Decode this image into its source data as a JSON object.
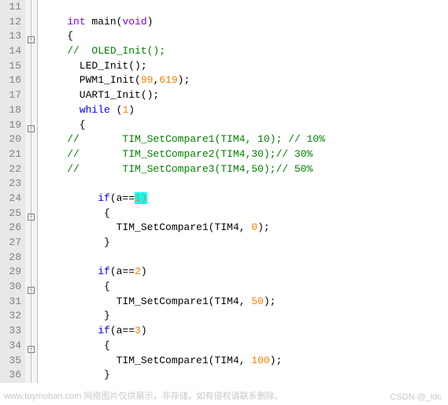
{
  "lines": [
    {
      "num": "11",
      "fold": "line",
      "code": ""
    },
    {
      "num": "12",
      "fold": "line",
      "segs": [
        {
          "t": "    "
        },
        {
          "t": "int",
          "c": "type"
        },
        {
          "t": " main("
        },
        {
          "t": "void",
          "c": "type"
        },
        {
          "t": ")"
        }
      ]
    },
    {
      "num": "13",
      "fold": "box",
      "segs": [
        {
          "t": "    {"
        }
      ]
    },
    {
      "num": "14",
      "fold": "line",
      "segs": [
        {
          "t": "    "
        },
        {
          "t": "//  OLED_Init();",
          "c": "comment"
        }
      ]
    },
    {
      "num": "15",
      "fold": "line",
      "segs": [
        {
          "t": "      LED_Init();"
        }
      ]
    },
    {
      "num": "16",
      "fold": "line",
      "segs": [
        {
          "t": "      PWM1_Init("
        },
        {
          "t": "99",
          "c": "num"
        },
        {
          "t": ","
        },
        {
          "t": "619",
          "c": "num"
        },
        {
          "t": ");"
        }
      ]
    },
    {
      "num": "17",
      "fold": "line",
      "segs": [
        {
          "t": "      UART1_Init();"
        }
      ]
    },
    {
      "num": "18",
      "fold": "line",
      "segs": [
        {
          "t": "      "
        },
        {
          "t": "while",
          "c": "kw"
        },
        {
          "t": " ("
        },
        {
          "t": "1",
          "c": "num"
        },
        {
          "t": ")"
        }
      ]
    },
    {
      "num": "19",
      "fold": "box",
      "segs": [
        {
          "t": "      {"
        }
      ]
    },
    {
      "num": "20",
      "fold": "line",
      "segs": [
        {
          "t": "    "
        },
        {
          "t": "//       TIM_SetCompare1(TIM4, 10); // 10%",
          "c": "comment"
        }
      ]
    },
    {
      "num": "21",
      "fold": "line",
      "segs": [
        {
          "t": "    "
        },
        {
          "t": "//       TIM_SetCompare2(TIM4,30);// 30%",
          "c": "comment"
        }
      ]
    },
    {
      "num": "22",
      "fold": "line",
      "segs": [
        {
          "t": "    "
        },
        {
          "t": "//       TIM_SetCompare3(TIM4,50);// 50%",
          "c": "comment"
        }
      ]
    },
    {
      "num": "23",
      "fold": "line",
      "code": ""
    },
    {
      "num": "24",
      "fold": "line",
      "segs": [
        {
          "t": "         "
        },
        {
          "t": "if",
          "c": "kw"
        },
        {
          "t": "(a=="
        },
        {
          "t": "1)",
          "c": "num highlight"
        }
      ]
    },
    {
      "num": "25",
      "fold": "box",
      "segs": [
        {
          "t": "          {"
        }
      ]
    },
    {
      "num": "26",
      "fold": "line",
      "segs": [
        {
          "t": "            TIM_SetCompare1(TIM4, "
        },
        {
          "t": "0",
          "c": "num"
        },
        {
          "t": ");"
        }
      ]
    },
    {
      "num": "27",
      "fold": "line",
      "segs": [
        {
          "t": "          }"
        }
      ]
    },
    {
      "num": "28",
      "fold": "line",
      "code": ""
    },
    {
      "num": "29",
      "fold": "line",
      "segs": [
        {
          "t": "         "
        },
        {
          "t": "if",
          "c": "kw"
        },
        {
          "t": "(a=="
        },
        {
          "t": "2",
          "c": "num"
        },
        {
          "t": ")"
        }
      ]
    },
    {
      "num": "30",
      "fold": "box",
      "segs": [
        {
          "t": "          {"
        }
      ]
    },
    {
      "num": "31",
      "fold": "line",
      "segs": [
        {
          "t": "            TIM_SetCompare1(TIM4, "
        },
        {
          "t": "50",
          "c": "num"
        },
        {
          "t": ");"
        }
      ]
    },
    {
      "num": "32",
      "fold": "line",
      "segs": [
        {
          "t": "          }"
        }
      ]
    },
    {
      "num": "33",
      "fold": "line",
      "segs": [
        {
          "t": "         "
        },
        {
          "t": "if",
          "c": "kw"
        },
        {
          "t": "(a=="
        },
        {
          "t": "3",
          "c": "num"
        },
        {
          "t": ")"
        }
      ]
    },
    {
      "num": "34",
      "fold": "box",
      "segs": [
        {
          "t": "          {"
        }
      ]
    },
    {
      "num": "35",
      "fold": "line",
      "segs": [
        {
          "t": "            TIM_SetCompare1(TIM4, "
        },
        {
          "t": "100",
          "c": "num"
        },
        {
          "t": ");"
        }
      ]
    },
    {
      "num": "36",
      "fold": "line",
      "segs": [
        {
          "t": "          }"
        }
      ]
    }
  ],
  "watermark": "www.toymoban.com  网络图片仅供展示，非存储，如有侵权请联系删除。",
  "csdn": "CSDN @_ldc"
}
